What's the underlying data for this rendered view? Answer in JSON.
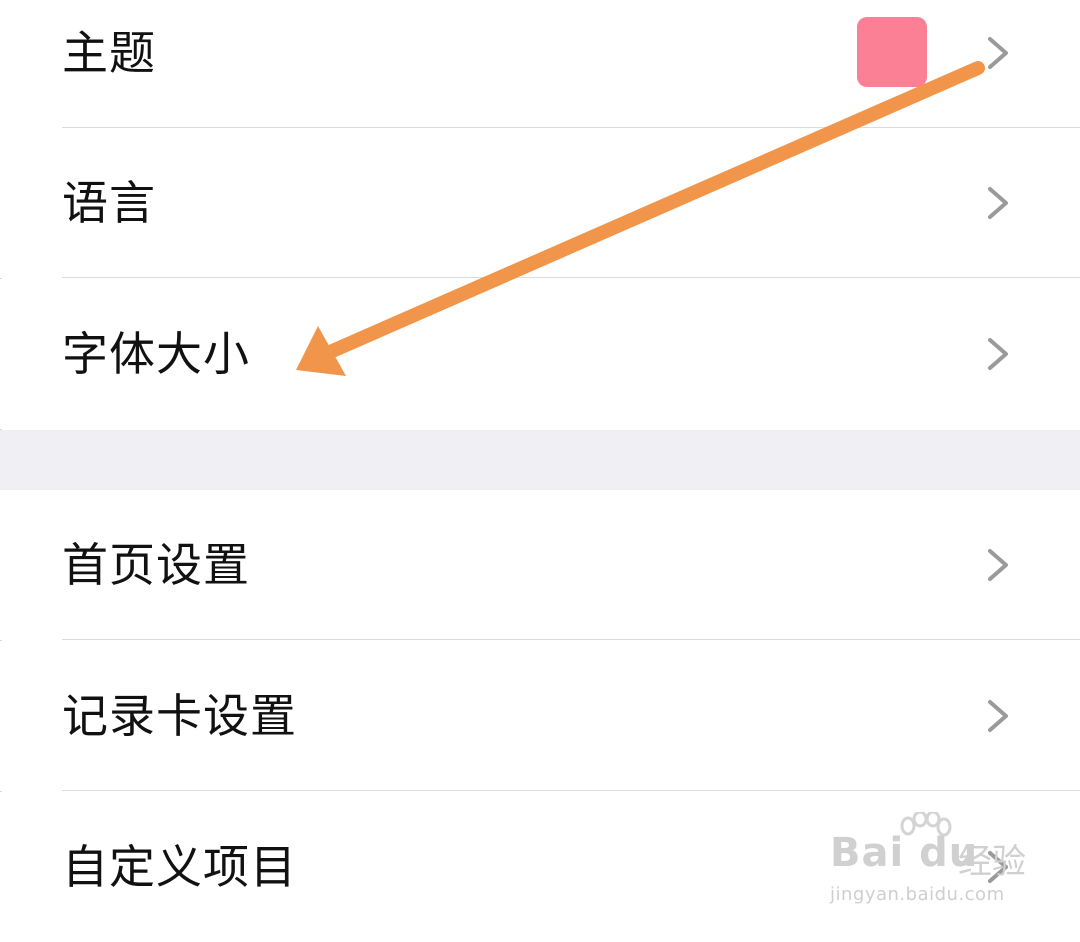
{
  "settings": {
    "group1": [
      {
        "label": "主题"
      },
      {
        "label": "语言"
      },
      {
        "label": "字体大小"
      }
    ],
    "group2": [
      {
        "label": "首页设置"
      },
      {
        "label": "记录卡设置"
      },
      {
        "label": "自定义项目"
      }
    ]
  },
  "theme_swatch_color": "#fb7f95",
  "annotation": {
    "type": "arrow",
    "color": "#f0954a",
    "points_to": "字体大小"
  },
  "watermark": {
    "brand": "Bai  du",
    "suffix": "经验",
    "url": "jingyan.baidu.com"
  },
  "icons": {
    "row_chevron": "chevron-right-icon",
    "watermark_logo": "paw-icon"
  }
}
